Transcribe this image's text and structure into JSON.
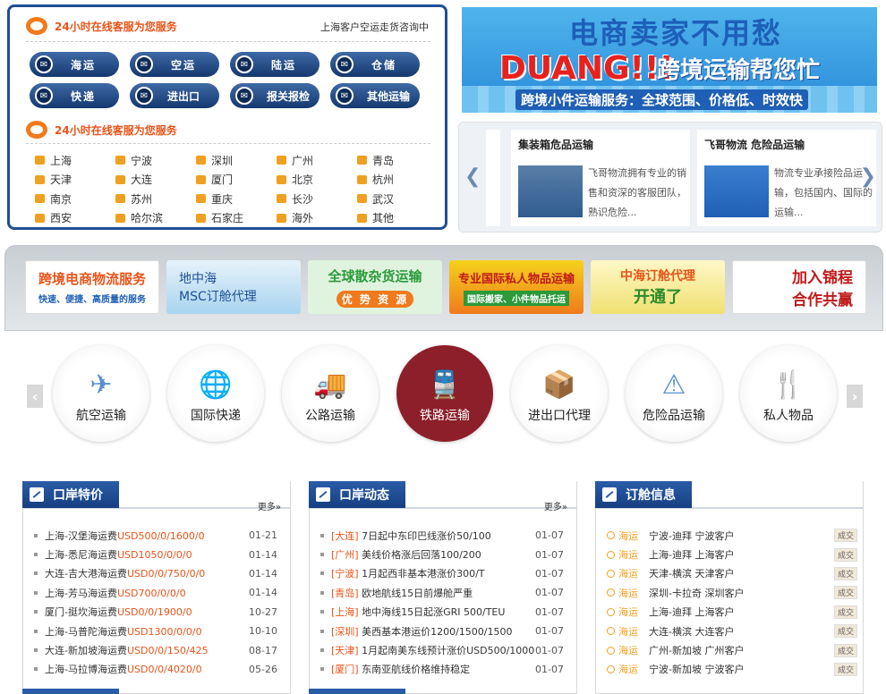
{
  "service": {
    "heading1": "24小时在线客服为您服务",
    "right_note": "上海客户空运走货咨询中",
    "buttons": [
      "海运",
      "空运",
      "陆运",
      "仓储",
      "快递",
      "进出口",
      "报关报检",
      "其他运输"
    ],
    "heading2": "24小时在线客服为您服务",
    "cities": [
      "上海",
      "宁波",
      "深圳",
      "广州",
      "青岛",
      "天津",
      "大连",
      "厦门",
      "北京",
      "杭州",
      "南京",
      "苏州",
      "重庆",
      "长沙",
      "武汉",
      "西安",
      "哈尔滨",
      "石家庄",
      "海外",
      "其他"
    ]
  },
  "banner": {
    "line1": "电商卖家不用愁",
    "duang": "DUANG!!!",
    "line2": "跨境运输帮您忙",
    "line3": "跨境小件运输服务：全球范围、价格低、时效快"
  },
  "slider": {
    "prev": "❮",
    "next": "❯",
    "cards": [
      {
        "title": "集装箱危品运输",
        "text": "飞哥物流拥有专业的销售和资深的客服团队，熟识危险..."
      },
      {
        "title": "飞哥物流 危险品运输",
        "text": "物流专业承接险品运输，包括国内、国际的运输..."
      }
    ]
  },
  "ads": [
    {
      "l1": "跨境电商物流服务",
      "l2": "快速、便捷、高质量的服务"
    },
    {
      "l1": "地中海",
      "l2": "MSC订舱代理"
    },
    {
      "l1": "全球散杂货运输",
      "l2": "优 势 资 源"
    },
    {
      "l1": "专业国际私人物品运输",
      "l2": "国际搬家、小件物品托运"
    },
    {
      "l1": "中海订舱代理",
      "l2": "开通了"
    },
    {
      "l1": "加入锦程",
      "l2": "合作共赢"
    }
  ],
  "categories": [
    {
      "label": "航空运输",
      "icon": "✈"
    },
    {
      "label": "国际快递",
      "icon": "🌐"
    },
    {
      "label": "公路运输",
      "icon": "🚚"
    },
    {
      "label": "铁路运输",
      "icon": "🚆"
    },
    {
      "label": "进出口代理",
      "icon": "📦"
    },
    {
      "label": "危险品运输",
      "icon": "⚠"
    },
    {
      "label": "私人物品",
      "icon": "🍴"
    }
  ],
  "cat_prev": "‹",
  "cat_next": "›",
  "panels": {
    "p1": {
      "title": "口岸特价",
      "more": "更多»",
      "rows": [
        {
          "route": "上海-汉堡海运费",
          "price": "USD500/0/1600/0",
          "date": "01-21"
        },
        {
          "route": "上海-悉尼海运费",
          "price": "USD1050/0/0/0",
          "date": "01-14"
        },
        {
          "route": "大连-吉大港海运费",
          "price": "USD0/0/750/0/0",
          "date": "01-14"
        },
        {
          "route": "上海-芳马海运费",
          "price": "USD700/0/0/0",
          "date": "01-14"
        },
        {
          "route": "厦门-挺坎海运费",
          "price": "USD0/0/1900/0",
          "date": "10-27"
        },
        {
          "route": "上海-马普陀海运费",
          "price": "USD1300/0/0/0",
          "date": "10-10"
        },
        {
          "route": "大连-新加坡海运费",
          "price": "USD0/0/150/425",
          "date": "08-17"
        },
        {
          "route": "上海-马拉博海运费",
          "price": "USD0/0/4020/0",
          "date": "05-26"
        }
      ]
    },
    "p2": {
      "title": "口岸动态",
      "more": "更多»",
      "rows": [
        {
          "tag": "[大连]",
          "text": "7日起中东印巴线涨价50/100",
          "date": "01-07"
        },
        {
          "tag": "[广州]",
          "text": "美线价格涨后回落100/200",
          "date": "01-07"
        },
        {
          "tag": "[宁波]",
          "text": "1月起西非基本港涨价300/T",
          "date": "01-07"
        },
        {
          "tag": "[青岛]",
          "text": "欧地航线15日前爆舱严重",
          "date": "01-07"
        },
        {
          "tag": "[上海]",
          "text": "地中海线15日起涨GRI 500/TEU",
          "date": "01-07"
        },
        {
          "tag": "[深圳]",
          "text": "美西基本港运价1200/1500/1500",
          "date": "01-07"
        },
        {
          "tag": "[天津]",
          "text": "1月起南美东线预计涨价USD500/1000",
          "date": "01-07"
        },
        {
          "tag": "[厦门]",
          "text": "东南亚航线价格维持稳定",
          "date": "01-07"
        }
      ]
    },
    "p3": {
      "title": "订舱信息",
      "rows": [
        {
          "mode": "海运",
          "route": "宁波-迪拜 宁波客户",
          "status": "成交"
        },
        {
          "mode": "海运",
          "route": "上海-迪拜 上海客户",
          "status": "成交"
        },
        {
          "mode": "海运",
          "route": "天津-横滨 天津客户",
          "status": "成交"
        },
        {
          "mode": "海运",
          "route": "深圳-卡拉奇 深圳客户",
          "status": "成交"
        },
        {
          "mode": "海运",
          "route": "上海-迪拜 上海客户",
          "status": "成交"
        },
        {
          "mode": "海运",
          "route": "大连-横滨 大连客户",
          "status": "成交"
        },
        {
          "mode": "海运",
          "route": "广州-新加坡 广州客户",
          "status": "成交"
        },
        {
          "mode": "海运",
          "route": "宁波-新加坡 宁波客户",
          "status": "成交"
        }
      ]
    }
  },
  "colors": {
    "navy": "#1f4f94",
    "orange": "#e8541a",
    "rail_active": "#8c1f2a"
  }
}
